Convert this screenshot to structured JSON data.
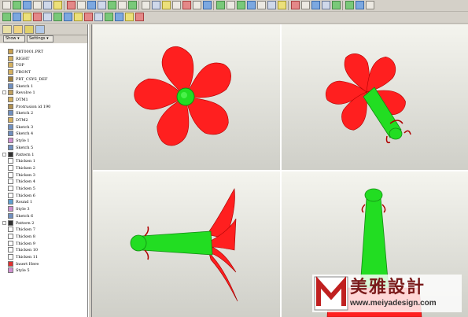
{
  "panel": {
    "buttons": {
      "show": "Show ▾",
      "settings": "Settings ▾"
    },
    "tree": [
      {
        "label": "PRT0001.PRT",
        "icon": "part-icon",
        "exp": false
      },
      {
        "label": "RIGHT",
        "icon": "datum-plane-icon",
        "exp": false
      },
      {
        "label": "TOP",
        "icon": "datum-plane-icon",
        "exp": false
      },
      {
        "label": "FRONT",
        "icon": "datum-plane-icon",
        "exp": false
      },
      {
        "label": "PRT_CSYS_DEF",
        "icon": "csys-icon",
        "exp": false
      },
      {
        "label": "Sketch 1",
        "icon": "sketch-icon",
        "exp": false
      },
      {
        "label": "Revolve 1",
        "icon": "revolve-icon",
        "exp": true
      },
      {
        "label": "DTM1",
        "icon": "datum-plane-icon",
        "exp": false
      },
      {
        "label": "Protrusion id 190",
        "icon": "protrusion-icon",
        "exp": false
      },
      {
        "label": "Sketch 2",
        "icon": "sketch-icon",
        "exp": false
      },
      {
        "label": "DTM2",
        "icon": "datum-plane-icon",
        "exp": false
      },
      {
        "label": "Sketch 3",
        "icon": "sketch-icon",
        "exp": false
      },
      {
        "label": "Sketch 4",
        "icon": "sketch-icon",
        "exp": false
      },
      {
        "label": "Style 1",
        "icon": "style-icon",
        "exp": false
      },
      {
        "label": "Sketch 5",
        "icon": "sketch-icon",
        "exp": false
      },
      {
        "label": "Pattern 1",
        "icon": "pattern-icon",
        "exp": true
      },
      {
        "label": "Thicken 1",
        "icon": "thicken-icon",
        "exp": false
      },
      {
        "label": "Thicken 2",
        "icon": "thicken-icon",
        "exp": false
      },
      {
        "label": "Thicken 3",
        "icon": "thicken-icon",
        "exp": false
      },
      {
        "label": "Thicken 4",
        "icon": "thicken-icon",
        "exp": false
      },
      {
        "label": "Thicken 5",
        "icon": "thicken-icon",
        "exp": false
      },
      {
        "label": "Thicken 6",
        "icon": "thicken-icon",
        "exp": false
      },
      {
        "label": "Round 1",
        "icon": "round-icon",
        "exp": false
      },
      {
        "label": "Style 3",
        "icon": "style-icon",
        "exp": false
      },
      {
        "label": "Sketch 6",
        "icon": "sketch-icon",
        "exp": false
      },
      {
        "label": "Pattern 2",
        "icon": "pattern-icon",
        "exp": true
      },
      {
        "label": "Thicken 7",
        "icon": "thicken-icon",
        "exp": false
      },
      {
        "label": "Thicken 8",
        "icon": "thicken-icon",
        "exp": false
      },
      {
        "label": "Thicken 9",
        "icon": "thicken-icon",
        "exp": false
      },
      {
        "label": "Thicken 10",
        "icon": "thicken-icon",
        "exp": false
      },
      {
        "label": "Thicken 11",
        "icon": "thicken-icon",
        "exp": false
      },
      {
        "label": "Insert Here",
        "icon": "insert-here-icon",
        "exp": false
      },
      {
        "label": "Style 5",
        "icon": "style-icon",
        "exp": false
      }
    ]
  },
  "watermark": {
    "title": "美雅設計",
    "url": "www.meiyadesign.com",
    "logo_letter": "M"
  },
  "colors": {
    "petal": "#ff2020",
    "stem": "#22dd22",
    "viewport_bg": "#e6e6df",
    "tree_bg": "#ffffff"
  }
}
